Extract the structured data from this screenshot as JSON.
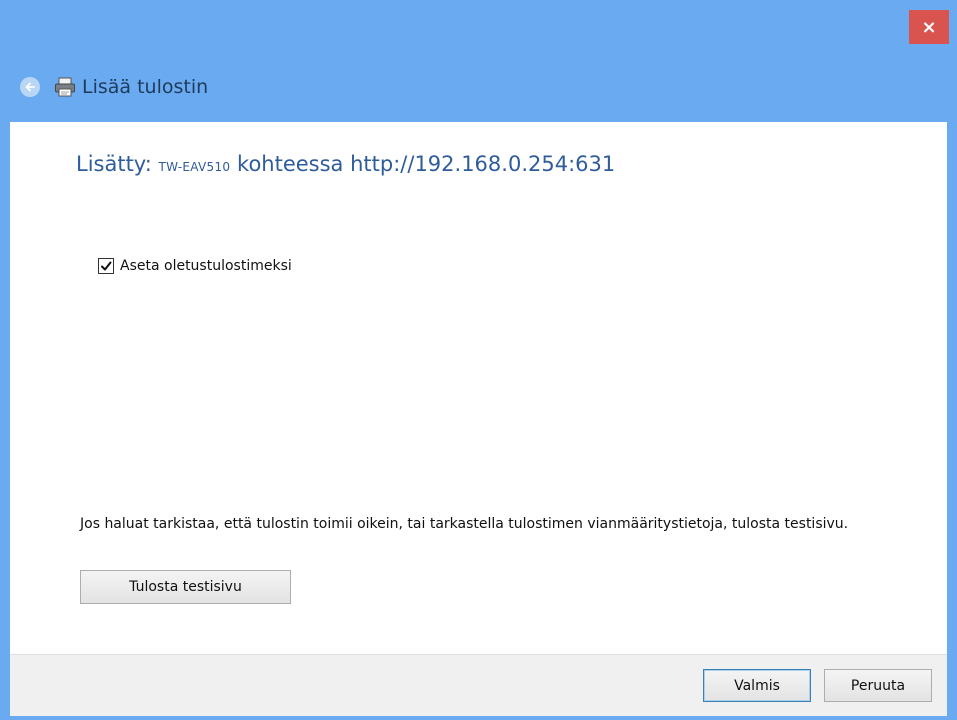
{
  "window": {
    "title": "Lisää tulostin",
    "close_label": "×",
    "accent_color": "#6aaaf0",
    "close_color": "#d9534f"
  },
  "main": {
    "heading_prefix": "Lisätty: ",
    "printer_name": "TW-EAV510",
    "heading_suffix": " kohteessa http://192.168.0.254:631",
    "default_checkbox": {
      "label": "Aseta oletustulostimeksi",
      "checked": true
    },
    "info_text": "Jos haluat tarkistaa, että tulostin toimii oikein, tai tarkastella tulostimen vianmääritystietoja, tulosta testisivu.",
    "test_page_button": "Tulosta testisivu"
  },
  "footer": {
    "finish_button": "Valmis",
    "cancel_button": "Peruuta"
  }
}
